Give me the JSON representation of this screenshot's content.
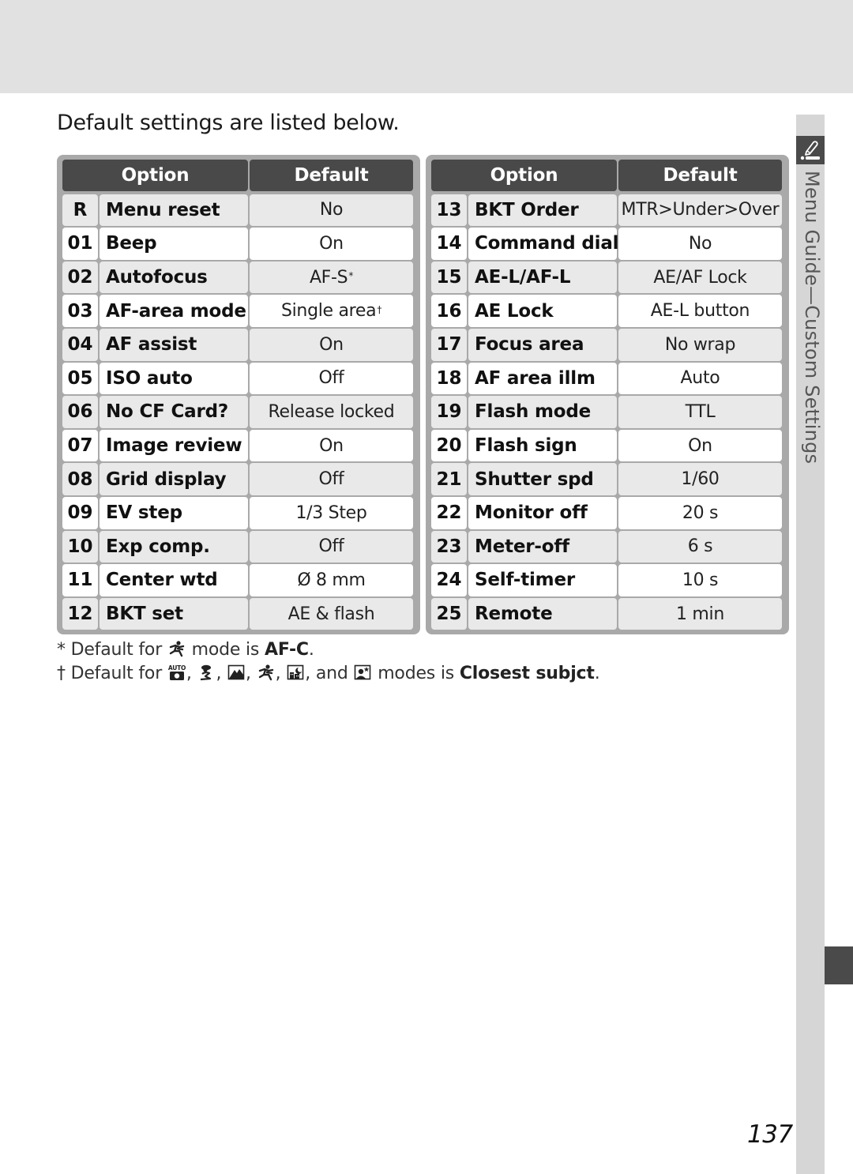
{
  "intro": "Default settings are listed below.",
  "tables": [
    {
      "headers": {
        "option": "Option",
        "default": "Default"
      },
      "rows": [
        {
          "num": "R",
          "name": "Menu reset",
          "value": "No",
          "note": ""
        },
        {
          "num": "01",
          "name": "Beep",
          "value": "On",
          "note": ""
        },
        {
          "num": "02",
          "name": "Autofocus",
          "value": "AF-S",
          "note": "*"
        },
        {
          "num": "03",
          "name": "AF-area mode",
          "value": "Single area",
          "note": "†"
        },
        {
          "num": "04",
          "name": "AF assist",
          "value": "On",
          "note": ""
        },
        {
          "num": "05",
          "name": "ISO auto",
          "value": "Off",
          "note": ""
        },
        {
          "num": "06",
          "name": "No CF Card?",
          "value": "Release locked",
          "note": ""
        },
        {
          "num": "07",
          "name": "Image review",
          "value": "On",
          "note": ""
        },
        {
          "num": "08",
          "name": "Grid display",
          "value": "Off",
          "note": ""
        },
        {
          "num": "09",
          "name": "EV step",
          "value": "1/3 Step",
          "note": ""
        },
        {
          "num": "10",
          "name": "Exp comp.",
          "value": "Off",
          "note": ""
        },
        {
          "num": "11",
          "name": "Center wtd",
          "value": "Ø 8 mm",
          "note": ""
        },
        {
          "num": "12",
          "name": "BKT set",
          "value": "AE & flash",
          "note": ""
        }
      ]
    },
    {
      "headers": {
        "option": "Option",
        "default": "Default"
      },
      "rows": [
        {
          "num": "13",
          "name": "BKT Order",
          "value": "MTR>Under>Over",
          "note": ""
        },
        {
          "num": "14",
          "name": "Command dial",
          "value": "No",
          "note": ""
        },
        {
          "num": "15",
          "name": "AE-L/AF-L",
          "value": "AE/AF Lock",
          "note": ""
        },
        {
          "num": "16",
          "name": "AE Lock",
          "value": "AE-L button",
          "note": ""
        },
        {
          "num": "17",
          "name": "Focus area",
          "value": "No wrap",
          "note": ""
        },
        {
          "num": "18",
          "name": "AF area illm",
          "value": "Auto",
          "note": ""
        },
        {
          "num": "19",
          "name": "Flash mode",
          "value": "TTL",
          "note": ""
        },
        {
          "num": "20",
          "name": "Flash sign",
          "value": "On",
          "note": ""
        },
        {
          "num": "21",
          "name": "Shutter spd",
          "value": "1/60",
          "note": ""
        },
        {
          "num": "22",
          "name": "Monitor off",
          "value": "20 s",
          "note": ""
        },
        {
          "num": "23",
          "name": "Meter-off",
          "value": "6 s",
          "note": ""
        },
        {
          "num": "24",
          "name": "Self-timer",
          "value": "10 s",
          "note": ""
        },
        {
          "num": "25",
          "name": "Remote",
          "value": "1 min",
          "note": ""
        }
      ]
    }
  ],
  "footnotes": {
    "f1": {
      "mark": "*",
      "pre": "Default for",
      "icon": "sports-mode-icon",
      "mid": "mode is",
      "bold": "AF-C",
      "end": "."
    },
    "f2": {
      "mark": "†",
      "pre": "Default for",
      "icons": [
        "auto-mode-icon",
        "portrait-mode-icon",
        "landscape-mode-icon",
        "sports-mode-icon",
        "night-landscape-mode-icon"
      ],
      "and": "and",
      "last_icon": "night-portrait-mode-icon",
      "mid": "modes is",
      "bold": "Closest subjct",
      "end": "."
    }
  },
  "sidebar": {
    "label": "Menu Guide—Custom Settings",
    "icon": "pencil-settings-icon"
  },
  "page_number": "137",
  "colors": {
    "header_bg": "#494949",
    "frame": "#a9a9a9",
    "row_alt": "#e9e9e9",
    "sidebar": "#d6d6d6",
    "top_band": "#e1e1e1"
  }
}
